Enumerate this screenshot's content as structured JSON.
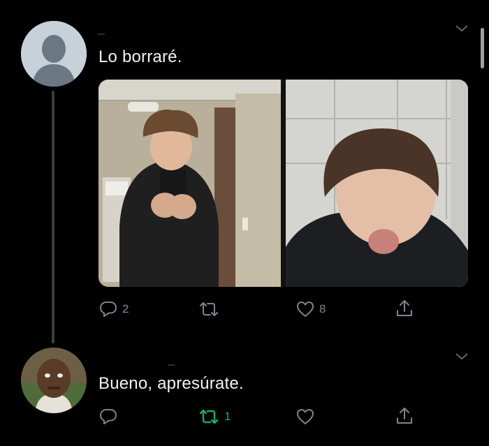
{
  "tweets": [
    {
      "text": "Lo borraré.",
      "actions": {
        "reply_count": "2",
        "retweet_count": "",
        "like_count": "8"
      }
    },
    {
      "text": "Bueno, apresúrate.",
      "actions": {
        "reply_count": "",
        "retweet_count": "1",
        "like_count": ""
      }
    }
  ],
  "colors": {
    "background": "#000000",
    "icon_gray": "#7d858c",
    "retweet_green": "#19ad67",
    "thread_line": "#3a3d41"
  },
  "icons": [
    "default-avatar-icon",
    "chevron-down-icon",
    "reply-icon",
    "retweet-icon",
    "heart-icon",
    "share-icon"
  ]
}
